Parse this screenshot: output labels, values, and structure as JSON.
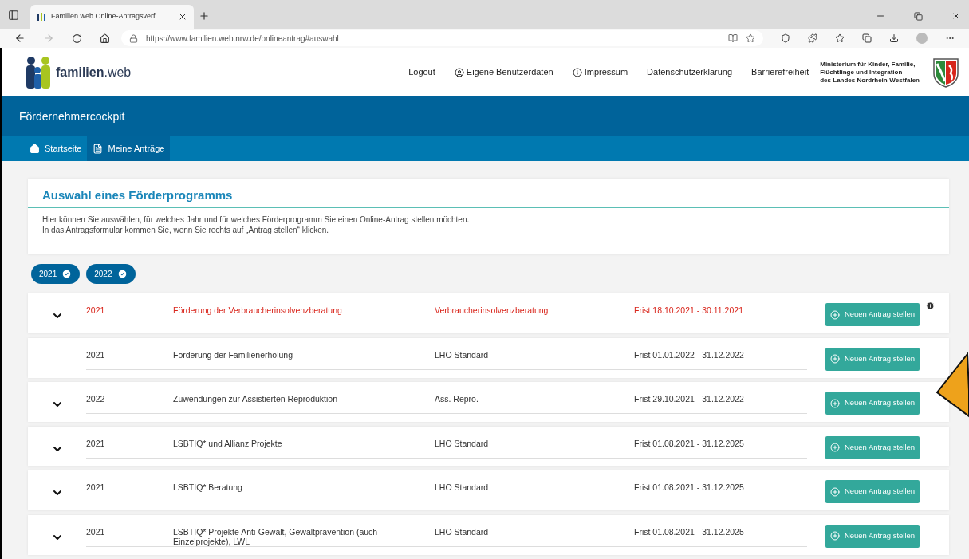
{
  "browser": {
    "tab_title": "Familien.web Online-Antragsverf",
    "url": "https://www.familien.web.nrw.de/onlineantrag#auswahl"
  },
  "header": {
    "logo_text": "**familien**.web",
    "nav": [
      {
        "label": "Logout",
        "kind": "plain"
      },
      {
        "label": "Eigene Benutzerdaten",
        "kind": "user"
      },
      {
        "label": "Impressum",
        "kind": "info"
      },
      {
        "label": "Datenschutzerklärung",
        "kind": "plain"
      },
      {
        "label": "Barrierefreiheit",
        "kind": "plain"
      }
    ],
    "ministry": "Ministerium für Kinder, Familie,\nFlüchtlinge und Integration\ndes Landes Nordrhein-Westfalen"
  },
  "banner": {
    "title": "Fördernehmercockpit"
  },
  "tabs": [
    {
      "label": "Startseite",
      "kind": "home",
      "selected": false
    },
    {
      "label": "Meine Anträge",
      "kind": "document",
      "selected": true
    }
  ],
  "intro": {
    "title": "Auswahl eines Förderprogramms",
    "text": "Hier können Sie auswählen, für welches Jahr und für welches Förderprogramm Sie einen Online-Antrag stellen möchten.\nIn das Antragsformular kommen Sie, wenn Sie rechts auf „Antrag stellen“ klicken."
  },
  "year_filters": [
    {
      "label": "2021",
      "selected": true
    },
    {
      "label": "2022",
      "selected": true
    }
  ],
  "programs": [
    {
      "year": "2021",
      "name": "Förderung der Verbraucherinsolvenzberatung",
      "type": "Verbraucherinsolvenzberatung",
      "period": "Frist 18.10.2021 - 30.11.2021",
      "button": "Neuen Antrag stellen",
      "highlighted": true,
      "expandable": true,
      "info": true
    },
    {
      "year": "2021",
      "name": "Förderung der Familienerholung",
      "type": "LHO Standard",
      "period": "Frist 01.01.2022 - 31.12.2022",
      "button": "Neuen Antrag stellen",
      "highlighted": false,
      "expandable": false,
      "info": false
    },
    {
      "year": "2022",
      "name": "Zuwendungen zur Assistierten Reproduktion",
      "type": "Ass. Repro.",
      "period": "Frist 29.10.2021 - 31.12.2022",
      "button": "Neuen Antrag stellen",
      "highlighted": false,
      "expandable": true,
      "info": false
    },
    {
      "year": "2021",
      "name": "LSBTIQ* und Allianz Projekte",
      "type": "LHO Standard",
      "period": "Frist 01.08.2021 - 31.12.2025",
      "button": "Neuen Antrag stellen",
      "highlighted": false,
      "expandable": true,
      "info": false
    },
    {
      "year": "2021",
      "name": "LSBTIQ* Beratung",
      "type": "LHO Standard",
      "period": "Frist 01.08.2021 - 31.12.2025",
      "button": "Neuen Antrag stellen",
      "highlighted": false,
      "expandable": true,
      "info": false
    },
    {
      "year": "2021",
      "name": "LSBTIQ* Projekte Anti-Gewalt, Gewaltprävention (auch Einzelprojekte), LWL",
      "type": "LHO Standard",
      "period": "Frist 01.08.2021 - 31.12.2025",
      "button": "Neuen Antrag stellen",
      "highlighted": false,
      "expandable": true,
      "info": false
    }
  ]
}
